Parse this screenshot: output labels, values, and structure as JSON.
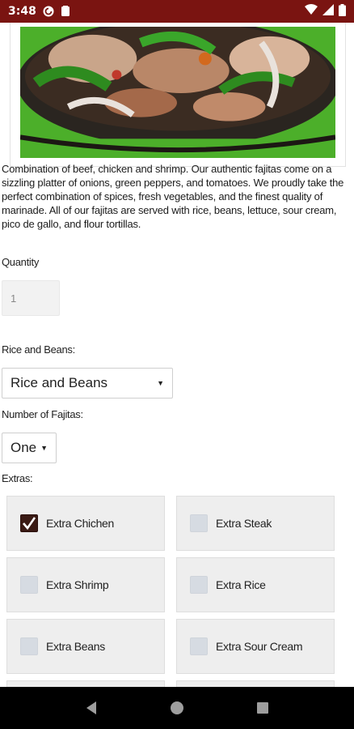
{
  "status_bar": {
    "time": "3:48",
    "icons_left": [
      "pocket-casts-icon",
      "clipboard-icon"
    ],
    "icons_right": [
      "wifi-icon",
      "signal-icon",
      "battery-icon"
    ],
    "background": "#7a1411"
  },
  "product": {
    "image_alt_icon": "fajitas-photo",
    "description": "Combination of beef, chicken and shrimp. Our authentic fajitas come on a sizzling platter of onions, green peppers, and tomatoes. We proudly take the perfect combination of spices, fresh vegetables, and the finest quality of marinade. All of our fajitas are served with rice, beans, lettuce, sour cream, pico de gallo, and flour tortillas."
  },
  "quantity": {
    "label": "Quantity",
    "value": "1"
  },
  "rice_and_beans": {
    "label": "Rice and Beans:",
    "selected": "Rice and Beans"
  },
  "number_of_fajitas": {
    "label": "Number of Fajitas:",
    "selected": "One"
  },
  "extras": {
    "label": "Extras:",
    "items": [
      {
        "label": "Extra Chichen",
        "checked": true
      },
      {
        "label": "Extra Steak",
        "checked": false
      },
      {
        "label": "Extra Shrimp",
        "checked": false
      },
      {
        "label": "Extra Rice",
        "checked": false
      },
      {
        "label": "Extra Beans",
        "checked": false
      },
      {
        "label": "Extra Sour Cream",
        "checked": false
      }
    ]
  },
  "nav": {
    "buttons": [
      "back-icon",
      "home-icon",
      "recents-icon"
    ]
  }
}
